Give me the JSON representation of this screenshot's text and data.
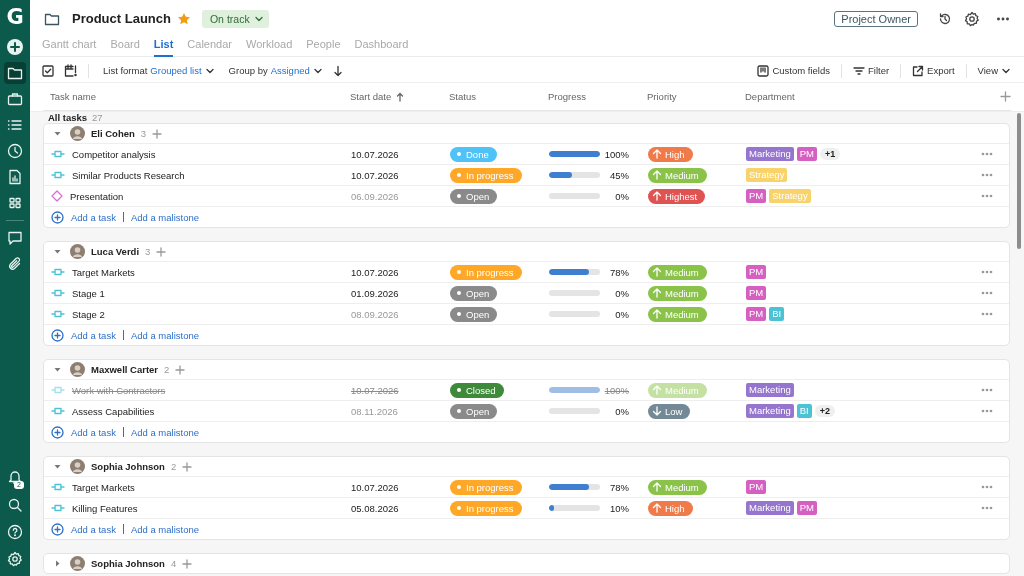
{
  "sidebar": {
    "logo": "G",
    "sections": [
      {
        "items": [
          {
            "kind": "add",
            "selected": false
          },
          {
            "kind": "folder",
            "selected": true
          },
          {
            "kind": "briefcase",
            "selected": false
          },
          {
            "kind": "list",
            "selected": false
          },
          {
            "kind": "clock",
            "selected": false
          },
          {
            "kind": "report",
            "selected": false
          },
          {
            "kind": "grid",
            "selected": false
          }
        ]
      },
      {
        "items": [
          {
            "kind": "chat",
            "selected": false
          },
          {
            "kind": "clip",
            "selected": false
          }
        ]
      }
    ],
    "bottom_items": [
      {
        "kind": "bell",
        "selected": false,
        "badge": "2"
      },
      {
        "kind": "search",
        "selected": false
      },
      {
        "kind": "help",
        "selected": false
      },
      {
        "kind": "settings",
        "selected": false
      }
    ]
  },
  "project": {
    "title": "Product Launch",
    "starred": true,
    "status": "On track"
  },
  "role": "Project Owner",
  "tabs": [
    {
      "label": "Gantt chart",
      "selected": false
    },
    {
      "label": "Board",
      "selected": false
    },
    {
      "label": "List",
      "selected": true
    },
    {
      "label": "Calendar",
      "selected": false
    },
    {
      "label": "Workload",
      "selected": false
    },
    {
      "label": "People",
      "selected": false
    },
    {
      "label": "Dashboard",
      "selected": false
    }
  ],
  "toolbar": {
    "list_format_label": "List format",
    "list_format": "Grouped list",
    "group_by_label": "Group by",
    "group_by": "Assigned",
    "actions": [
      {
        "kind": "custom_fields",
        "label": "Custom fields"
      },
      {
        "kind": "filter",
        "label": "Filter"
      },
      {
        "kind": "export",
        "label": "Export"
      },
      {
        "kind": "view",
        "label": "View"
      }
    ]
  },
  "columns": [
    {
      "label": "Task name",
      "sorted": false
    },
    {
      "label": "Start date",
      "sorted": true
    },
    {
      "label": "Status",
      "sorted": false
    },
    {
      "label": "Progress",
      "sorted": false
    },
    {
      "label": "Priority",
      "sorted": false
    },
    {
      "label": "Department",
      "sorted": false
    }
  ],
  "all_tasks": {
    "label": "All tasks",
    "count": "27"
  },
  "groups": [
    {
      "name": "Eli Cohen",
      "count": "3",
      "expanded": true,
      "add_links": [
        "Add a task",
        "Add a malistone"
      ],
      "tasks": [
        {
          "name": "Competitor analysis",
          "kind": "task",
          "closed": false,
          "start": "10.07.2026",
          "start_muted": false,
          "status": {
            "label": "Done",
            "kind": "done"
          },
          "level": 1,
          "percent": "100%",
          "priority": {
            "label": "High",
            "kind": "high"
          },
          "departments": [
            {
              "label": "Marketing",
              "color": "#9575cd"
            },
            {
              "label": "PM",
              "color": "#d65fc2"
            }
          ],
          "more": "+1"
        },
        {
          "name": "Similar Products Research",
          "kind": "task",
          "closed": false,
          "start": "10.07.2026",
          "start_muted": false,
          "status": {
            "label": "In progress",
            "kind": "in_progress"
          },
          "level": 0.45,
          "percent": "45%",
          "priority": {
            "label": "Medium",
            "kind": "medium"
          },
          "departments": [
            {
              "label": "Strategy",
              "color": "#f8d26a"
            }
          ]
        },
        {
          "name": "Presentation",
          "kind": "milestone",
          "closed": false,
          "start": "06.09.2026",
          "start_muted": true,
          "status": {
            "label": "Open",
            "kind": "open"
          },
          "level": 0,
          "percent": "0%",
          "priority": {
            "label": "Highest",
            "kind": "highest"
          },
          "departments": [
            {
              "label": "PM",
              "color": "#d65fc2"
            },
            {
              "label": "Strategy",
              "color": "#f8d26a"
            }
          ]
        }
      ]
    },
    {
      "name": "Luca Verdi",
      "count": "3",
      "expanded": true,
      "add_links": [
        "Add a task",
        "Add a malistone"
      ],
      "tasks": [
        {
          "name": "Target Markets",
          "kind": "task",
          "closed": false,
          "start": "10.07.2026",
          "start_muted": false,
          "status": {
            "label": "In progress",
            "kind": "in_progress"
          },
          "level": 0.78,
          "percent": "78%",
          "priority": {
            "label": "Medium",
            "kind": "medium"
          },
          "departments": [
            {
              "label": "PM",
              "color": "#d65fc2"
            }
          ]
        },
        {
          "name": "Stage 1",
          "kind": "task",
          "closed": false,
          "start": "01.09.2026",
          "start_muted": false,
          "status": {
            "label": "Open",
            "kind": "open"
          },
          "level": 0,
          "percent": "0%",
          "priority": {
            "label": "Medium",
            "kind": "medium"
          },
          "departments": [
            {
              "label": "PM",
              "color": "#d65fc2"
            }
          ]
        },
        {
          "name": "Stage 2",
          "kind": "task",
          "closed": false,
          "start": "08.09.2026",
          "start_muted": true,
          "status": {
            "label": "Open",
            "kind": "open"
          },
          "level": 0,
          "percent": "0%",
          "priority": {
            "label": "Medium",
            "kind": "medium"
          },
          "departments": [
            {
              "label": "PM",
              "color": "#d65fc2"
            },
            {
              "label": "BI",
              "color": "#4cc3d5"
            }
          ]
        }
      ]
    },
    {
      "name": "Maxwell Carter",
      "count": "2",
      "expanded": true,
      "add_links": [
        "Add a task",
        "Add a malistone"
      ],
      "tasks": [
        {
          "name": "Work with Contractors",
          "kind": "task",
          "closed": true,
          "start": "10.07.2026",
          "start_muted": true,
          "status": {
            "label": "Closed",
            "kind": "closed"
          },
          "level": 1,
          "percent": "100%",
          "priority": {
            "label": "Medium",
            "kind": "medium"
          },
          "departments": [
            {
              "label": "Marketing",
              "color": "#9575cd"
            }
          ]
        },
        {
          "name": "Assess Capabilities",
          "kind": "task",
          "closed": false,
          "start": "08.11.2026",
          "start_muted": true,
          "status": {
            "label": "Open",
            "kind": "open"
          },
          "level": 0,
          "percent": "0%",
          "priority": {
            "label": "Low",
            "kind": "low"
          },
          "departments": [
            {
              "label": "Marketing",
              "color": "#9575cd"
            },
            {
              "label": "BI",
              "color": "#4cc3d5"
            }
          ],
          "more": "+2"
        }
      ]
    },
    {
      "name": "Sophia Johnson",
      "count": "2",
      "expanded": true,
      "add_links": [
        "Add a task",
        "Add a malistone"
      ],
      "tasks": [
        {
          "name": "Target Markets",
          "kind": "task",
          "closed": false,
          "start": "10.07.2026",
          "start_muted": false,
          "status": {
            "label": "In progress",
            "kind": "in_progress"
          },
          "level": 0.78,
          "percent": "78%",
          "priority": {
            "label": "Medium",
            "kind": "medium"
          },
          "departments": [
            {
              "label": "PM",
              "color": "#d65fc2"
            }
          ]
        },
        {
          "name": "Killing Features",
          "kind": "task",
          "closed": false,
          "start": "05.08.2026",
          "start_muted": false,
          "status": {
            "label": "In progress",
            "kind": "in_progress"
          },
          "level": 0.1,
          "percent": "10%",
          "priority": {
            "label": "High",
            "kind": "high"
          },
          "departments": [
            {
              "label": "Marketing",
              "color": "#9575cd"
            },
            {
              "label": "PM",
              "color": "#d65fc2"
            }
          ]
        }
      ]
    },
    {
      "name": "Sophia Johnson",
      "count": "4",
      "expanded": false
    }
  ]
}
